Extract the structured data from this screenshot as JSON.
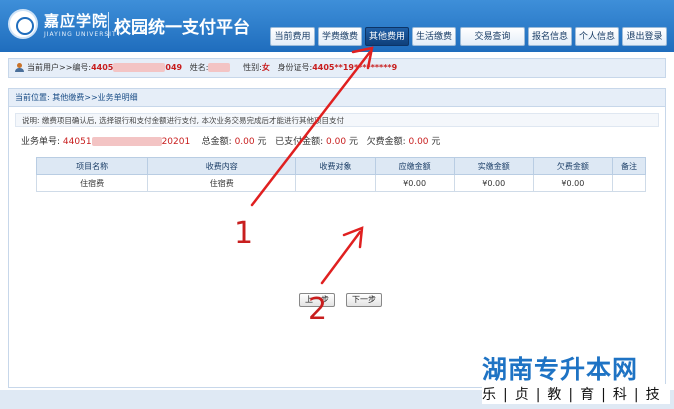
{
  "header": {
    "school_name": "嘉应学院",
    "school_en": "JIAYING UNIVERSITY",
    "platform_title": "校园统一支付平台"
  },
  "nav": [
    {
      "label": "当前费用"
    },
    {
      "label": "学费缴费"
    },
    {
      "label": "其他费用"
    },
    {
      "label": "生活缴费"
    },
    {
      "label": "交易查询"
    },
    {
      "label": "报名信息"
    },
    {
      "label": "个人信息"
    },
    {
      "label": "退出登录"
    }
  ],
  "user": {
    "prefix": "当前用户>>编号:",
    "id_start": "4405",
    "id_end": "049",
    "name_label": "姓名:",
    "gender_label": "性别:",
    "gender": "女",
    "idcard_label": "身份证号:",
    "idcard": "4405**19*********9"
  },
  "breadcrumb": "当前位置: 其他缴费>>业务单明细",
  "description": "说明: 缴费项目确认后, 选择银行和支付金额进行支付, 本次业务交易完成后才能进行其他项目支付",
  "summary": {
    "order_label": "业务单号:",
    "order_start": "44051",
    "order_end": "20201",
    "total_label": "总金额:",
    "total_value": "0.00",
    "paid_label": "已支付金额:",
    "paid_value": "0.00",
    "owe_label": "欠费金额:",
    "owe_value": "0.00",
    "unit": "元"
  },
  "table": {
    "headers": [
      "项目名称",
      "收费内容",
      "收费对象",
      "应缴金额",
      "实缴金额",
      "欠费金额",
      "备注"
    ],
    "rows": [
      [
        "住宿费",
        "住宿费",
        "",
        "¥0.00",
        "¥0.00",
        "¥0.00",
        ""
      ]
    ]
  },
  "buttons": {
    "prev": "上一步",
    "next": "下一步"
  },
  "annotations": {
    "one": "1",
    "two": "2",
    "arrow_color": "#e02020"
  },
  "watermark": {
    "title": "湖南专升本网",
    "subtitle": "乐|贞|教|育|科|技"
  }
}
